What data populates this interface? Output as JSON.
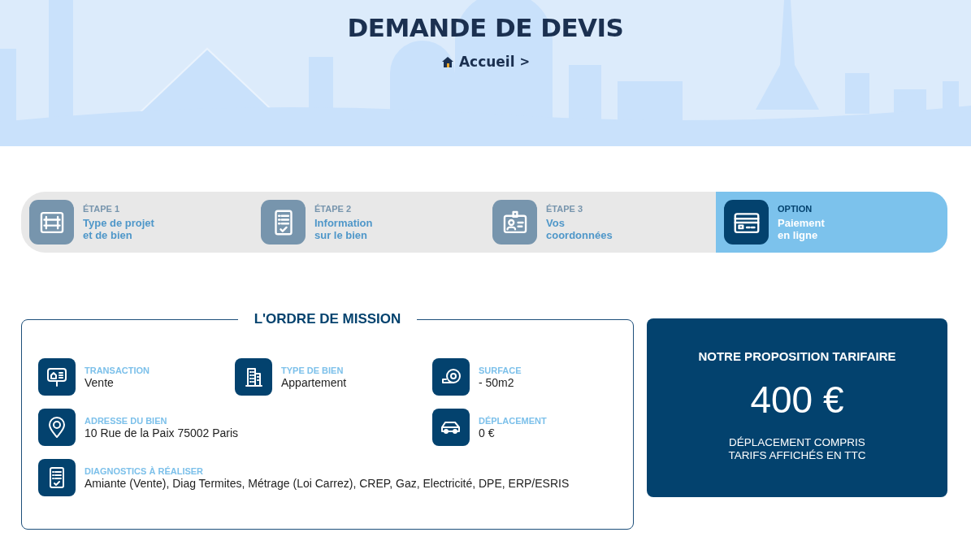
{
  "header": {
    "title": "DEMANDE DE DEVIS",
    "breadcrumb": "Accueil",
    "breadcrumb_separator": ">"
  },
  "steps": [
    {
      "step": "ÉTAPE 1",
      "label": "Type de projet\net de bien",
      "selected": false
    },
    {
      "step": "ÉTAPE 2",
      "label": "Information\nsur le bien",
      "selected": false
    },
    {
      "step": "ÉTAPE 3",
      "label": "Vos\ncoordonnées",
      "selected": false
    },
    {
      "step": "OPTION",
      "label": "Paiement\nen ligne",
      "selected": true
    }
  ],
  "mission": {
    "title": "L'ORDRE DE MISSION",
    "rows": [
      [
        {
          "label": "TRANSACTION",
          "value": "Vente"
        },
        {
          "label": "TYPE DE BIEN",
          "value": "Appartement"
        },
        {
          "label": "SURFACE",
          "value": "- 50m2"
        }
      ],
      [
        {
          "label": "ADRESSE DU BIEN",
          "value": "10 Rue de la Paix 75002 Paris"
        },
        "",
        {
          "label": "DÉPLACEMENT",
          "value": "0 €"
        }
      ],
      [
        {
          "label": "DIAGNOSTICS À RÉALISER",
          "value": "Amiante (Vente), Diag Termites, Métrage (Loi Carrez), CREP, Gaz, Electricité, DPE, ERP/ESRIS"
        }
      ]
    ]
  },
  "price": {
    "title": "NOTRE PROPOSITION TARIFAIRE",
    "amount": "400 €",
    "notes": [
      "DÉPLACEMENT COMPRIS",
      "TARIFS AFFICHÉS EN TTC"
    ]
  }
}
